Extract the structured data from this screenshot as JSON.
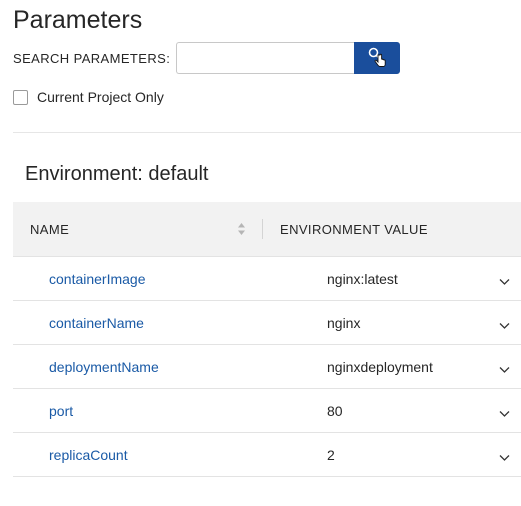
{
  "page": {
    "title": "Parameters"
  },
  "search": {
    "label": "SEARCH PARAMETERS:",
    "value": "",
    "placeholder": "",
    "button_icon": "search-icon"
  },
  "filter": {
    "checkbox_label": "Current Project Only",
    "checked": false
  },
  "environment": {
    "heading": "Environment: default",
    "columns": {
      "name": "NAME",
      "value": "ENVIRONMENT VALUE"
    },
    "rows": [
      {
        "name": "containerImage",
        "value": "nginx:latest"
      },
      {
        "name": "containerName",
        "value": "nginx"
      },
      {
        "name": "deploymentName",
        "value": "nginxdeployment"
      },
      {
        "name": "port",
        "value": "80"
      },
      {
        "name": "replicaCount",
        "value": "2"
      }
    ]
  },
  "colors": {
    "accent": "#1a4e9c",
    "link": "#1a5aa6",
    "header_bg": "#f2f2f2"
  }
}
